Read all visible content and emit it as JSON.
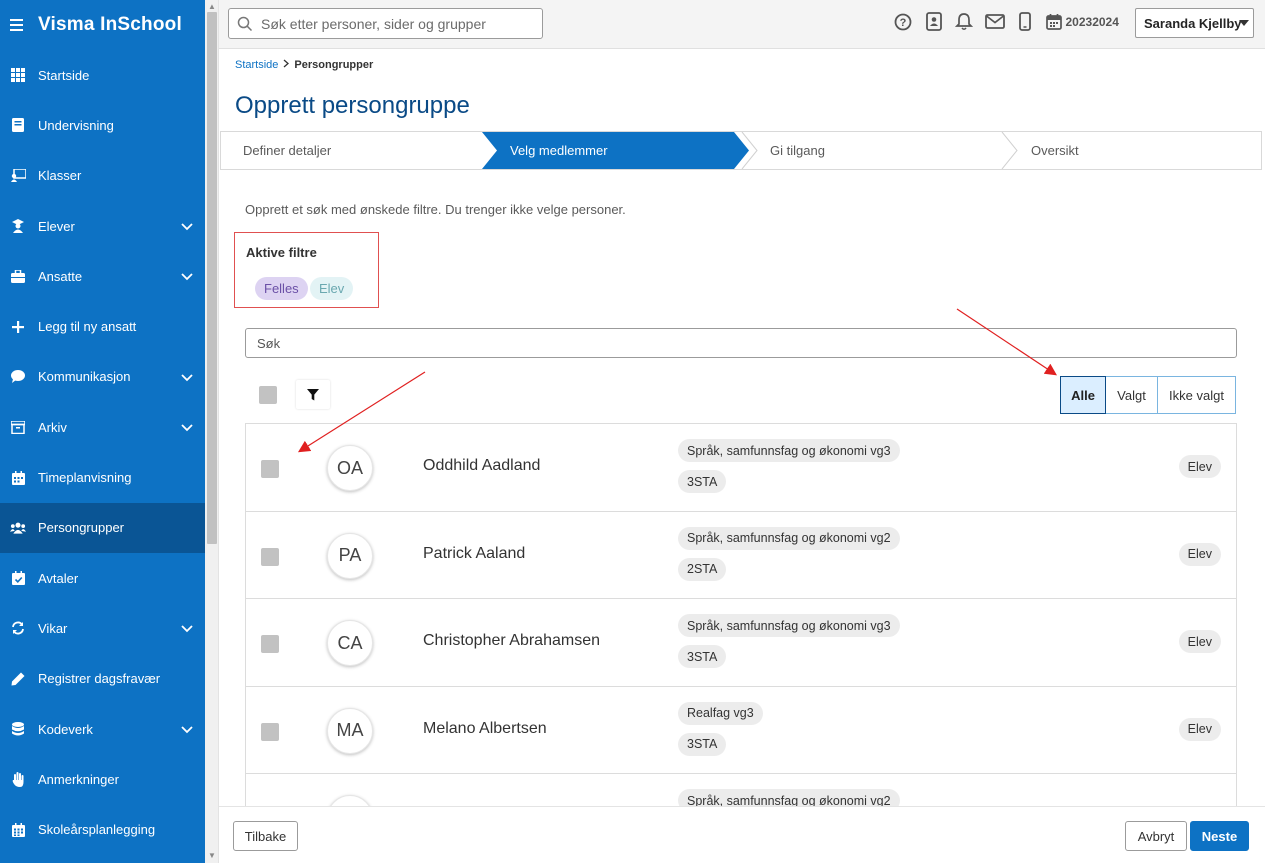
{
  "app": {
    "title": "Visma InSchool",
    "menu_icon": "hamburger-icon"
  },
  "sidebar": {
    "items": [
      {
        "label": "Startside",
        "icon": "grid-icon",
        "expandable": false,
        "active": false
      },
      {
        "label": "Undervisning",
        "icon": "book-icon",
        "expandable": false,
        "active": false
      },
      {
        "label": "Klasser",
        "icon": "classroom-icon",
        "expandable": false,
        "active": false
      },
      {
        "label": "Elever",
        "icon": "student-icon",
        "expandable": true,
        "active": false
      },
      {
        "label": "Ansatte",
        "icon": "briefcase-icon",
        "expandable": true,
        "active": false
      },
      {
        "label": "Legg til ny ansatt",
        "icon": "plus-icon",
        "expandable": false,
        "active": false
      },
      {
        "label": "Kommunikasjon",
        "icon": "chat-icon",
        "expandable": true,
        "active": false
      },
      {
        "label": "Arkiv",
        "icon": "archive-icon",
        "expandable": true,
        "active": false
      },
      {
        "label": "Timeplanvisning",
        "icon": "calendar-icon",
        "expandable": false,
        "active": false
      },
      {
        "label": "Persongrupper",
        "icon": "people-icon",
        "expandable": false,
        "active": true
      },
      {
        "label": "Avtaler",
        "icon": "calendar-check-icon",
        "expandable": false,
        "active": false
      },
      {
        "label": "Vikar",
        "icon": "swap-icon",
        "expandable": true,
        "active": false
      },
      {
        "label": "Registrer dagsfravær",
        "icon": "pencil-icon",
        "expandable": false,
        "active": false
      },
      {
        "label": "Kodeverk",
        "icon": "database-icon",
        "expandable": true,
        "active": false
      },
      {
        "label": "Anmerkninger",
        "icon": "hand-icon",
        "expandable": false,
        "active": false
      },
      {
        "label": "Skoleårsplanlegging",
        "icon": "calendar-grid-icon",
        "expandable": false,
        "active": false
      }
    ]
  },
  "topbar": {
    "search_placeholder": "Søk etter personer, sider og grupper",
    "year": "20232024",
    "user": "Saranda Kjellby"
  },
  "breadcrumb": {
    "home": "Startside",
    "current": "Persongrupper"
  },
  "page_title": "Opprett persongruppe",
  "steps": [
    {
      "label": "Definer detaljer",
      "active": false
    },
    {
      "label": "Velg medlemmer",
      "active": true
    },
    {
      "label": "Gi tilgang",
      "active": false
    },
    {
      "label": "Oversikt",
      "active": false
    }
  ],
  "intro": "Opprett et søk med ønskede filtre. Du trenger ikke velge personer.",
  "active_filters": {
    "title": "Aktive filtre",
    "chips": [
      "Felles",
      "Elev"
    ]
  },
  "list_search_placeholder": "Søk",
  "segments": [
    {
      "label": "Alle",
      "active": true
    },
    {
      "label": "Valgt",
      "active": false
    },
    {
      "label": "Ikke valgt",
      "active": false
    }
  ],
  "people": [
    {
      "initials": "OA",
      "name": "Oddhild Aadland",
      "program": "Språk, samfunnsfag og økonomi vg3",
      "class": "3STA",
      "role": "Elev"
    },
    {
      "initials": "PA",
      "name": "Patrick Aaland",
      "program": "Språk, samfunnsfag og økonomi vg2",
      "class": "2STA",
      "role": "Elev"
    },
    {
      "initials": "CA",
      "name": "Christopher Abrahamsen",
      "program": "Språk, samfunnsfag og økonomi vg3",
      "class": "3STA",
      "role": "Elev"
    },
    {
      "initials": "MA",
      "name": "Melano Albertsen",
      "program": "Realfag vg3",
      "class": "3STA",
      "role": "Elev"
    },
    {
      "initials": "",
      "name": "",
      "program": "Språk, samfunnsfag og økonomi vg2",
      "class": "",
      "role": ""
    }
  ],
  "footer": {
    "back": "Tilbake",
    "cancel": "Avbryt",
    "next": "Neste"
  },
  "colors": {
    "sidebar": "#0d72c4",
    "sidebar_active": "#0a5595",
    "title": "#0a4a86",
    "annotation": "#e02020"
  }
}
